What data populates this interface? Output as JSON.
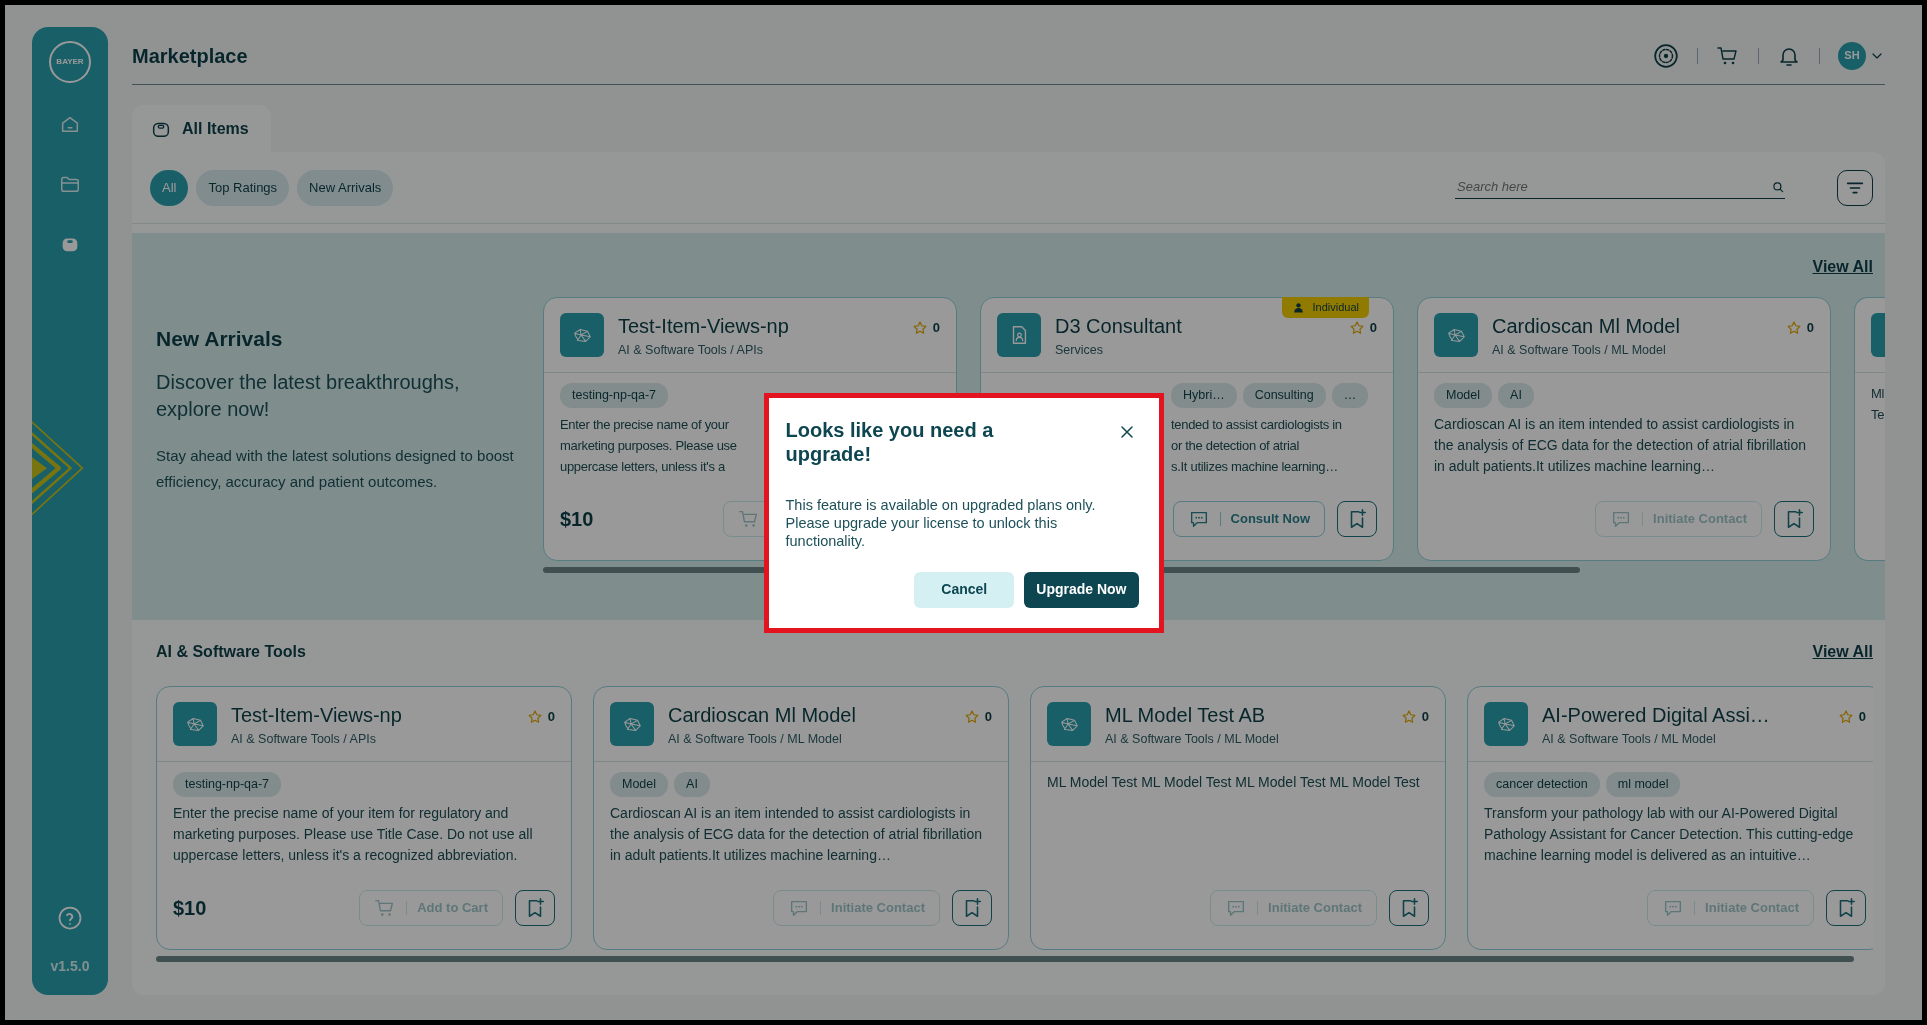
{
  "sidebar": {
    "logo": "BAYER",
    "items": [
      {
        "kind": "home",
        "selected": false
      },
      {
        "kind": "folder",
        "selected": false
      },
      {
        "kind": "bag",
        "selected": true
      }
    ],
    "version": "v1.5.0"
  },
  "header": {
    "title": "Marketplace",
    "avatar": "SH"
  },
  "tabs": [
    {
      "label": "All Items",
      "selected": true
    }
  ],
  "filters": [
    {
      "label": "All",
      "selected": true
    },
    {
      "label": "Top Ratings",
      "selected": false
    },
    {
      "label": "New Arrivals",
      "selected": false
    }
  ],
  "search": {
    "placeholder": "Search here"
  },
  "new_arrivals": {
    "title": "New Arrivals",
    "headline": "Discover the latest breakthroughs, explore now!",
    "description": "Stay ahead with the latest solutions designed to boost efficiency, accuracy and patient outcomes.",
    "view_all": "View All",
    "cards": [
      {
        "kind": "product",
        "title": "Test-Item-Views-np",
        "category": "AI & Software Tools / APIs",
        "rating": "0",
        "tags": [
          "testing-np-qa-7"
        ],
        "description_lines": [
          "Enter the precise name of your",
          "marketing purposes. Please use",
          "uppercase letters, unless it's a"
        ],
        "price": "$10",
        "action": {
          "kind": "cart",
          "disabled": true
        }
      },
      {
        "kind": "service",
        "badge": "Individual",
        "title": "D3 Consultant",
        "category": "Services",
        "rating": "0",
        "tags": [
          "Hybri…",
          "Consulting",
          "…"
        ],
        "description_lines": [
          "tended to assist cardiologists in",
          "or the detection of atrial",
          "s.It utilizes machine learning…"
        ],
        "action": {
          "kind": "contact",
          "label": "Consult Now",
          "disabled": false
        }
      },
      {
        "kind": "product",
        "title": "Cardioscan Ml Model",
        "category": "AI & Software Tools / ML Model",
        "rating": "0",
        "tags": [
          "Model",
          "AI"
        ],
        "description": "Cardioscan AI is an item intended to assist cardiologists in the analysis of ECG data for the detection of atrial fibrillation in adult patients.It utilizes machine learning…",
        "action": {
          "kind": "contact",
          "label": "Initiate Contact",
          "disabled": true
        }
      },
      {
        "kind": "edge",
        "description_lines": [
          "Ml",
          "Te"
        ]
      }
    ]
  },
  "sections": [
    {
      "title": "AI & Software Tools",
      "view_all": "View All",
      "cards": [
        {
          "kind": "product",
          "title": "Test-Item-Views-np",
          "category": "AI & Software Tools / APIs",
          "rating": "0",
          "tags": [
            "testing-np-qa-7"
          ],
          "description": "Enter the precise name of your item for regulatory and marketing purposes. Please use Title Case. Do not use all uppercase letters, unless it's a recognized abbreviation.",
          "price": "$10",
          "action": {
            "kind": "cart",
            "label": "Add to Cart",
            "disabled": true
          }
        },
        {
          "kind": "product",
          "title": "Cardioscan Ml Model",
          "category": "AI & Software Tools / ML Model",
          "rating": "0",
          "tags": [
            "Model",
            "AI"
          ],
          "description": "Cardioscan AI is an item intended to assist cardiologists in the analysis of ECG data for the detection of atrial fibrillation in adult patients.It utilizes machine learning…",
          "action": {
            "kind": "contact",
            "label": "Initiate Contact",
            "disabled": true
          }
        },
        {
          "kind": "product",
          "title": "ML Model Test AB",
          "category": "AI & Software Tools / ML Model",
          "rating": "0",
          "description": "ML Model Test ML Model Test ML Model Test ML Model Test",
          "action": {
            "kind": "contact",
            "label": "Initiate Contact",
            "disabled": true
          }
        },
        {
          "kind": "product",
          "title": "AI-Powered Digital Assi…",
          "category": "AI & Software Tools / ML Model",
          "rating": "0",
          "tags": [
            "cancer detection",
            "ml model"
          ],
          "description": "Transform your pathology lab with our AI-Powered Digital Pathology Assistant for Cancer Detection. This cutting-edge machine learning model is delivered as an intuitive…",
          "action": {
            "kind": "contact",
            "label": "Initiate Contact",
            "disabled": true
          }
        }
      ]
    }
  ],
  "modal": {
    "title": "Looks like you need a upgrade!",
    "message": "This feature is available on upgraded plans only. Please upgrade your license to unlock this functionality.",
    "buttons": [
      {
        "kind": "secondary",
        "label": "Cancel"
      },
      {
        "kind": "primary",
        "label": "Upgrade Now"
      }
    ]
  }
}
